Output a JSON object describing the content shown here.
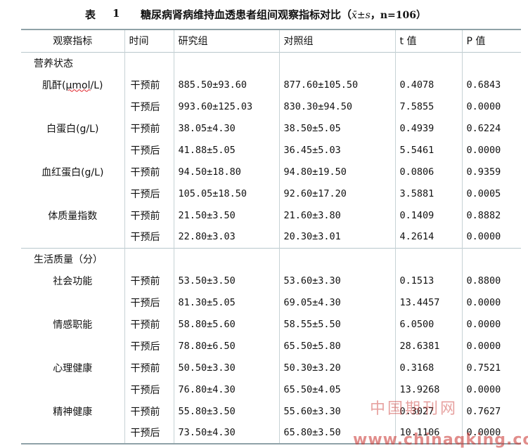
{
  "caption": {
    "label": "表",
    "number": "1",
    "title": "糖尿病肾病维持血透患者组间观察指标对比（",
    "stat": "x̄±s",
    "n": "，n=106）"
  },
  "headers": [
    "观察指标",
    "时间",
    "研究组",
    "对照组",
    "t 值",
    "P 值"
  ],
  "groups": [
    {
      "label": "营养状态",
      "rows": [
        {
          "indicator": "肌酐(μmol/L)",
          "time": "干预前",
          "study": "885.50±93.60",
          "control": "877.60±105.50",
          "t": "0.4078",
          "p": "0.6843"
        },
        {
          "indicator": "",
          "time": "干预后",
          "study": "993.60±125.03",
          "control": "830.30±94.50",
          "t": "7.5855",
          "p": "0.0000"
        },
        {
          "indicator": "白蛋白(g/L)",
          "time": "干预前",
          "study": "38.05±4.30",
          "control": "38.50±5.05",
          "t": "0.4939",
          "p": "0.6224"
        },
        {
          "indicator": "",
          "time": "干预后",
          "study": "41.88±5.05",
          "control": "36.45±5.03",
          "t": "5.5461",
          "p": "0.0000"
        },
        {
          "indicator": "血红蛋白(g/L)",
          "time": "干预前",
          "study": "94.50±18.80",
          "control": "94.80±19.50",
          "t": "0.0806",
          "p": "0.9359"
        },
        {
          "indicator": "",
          "time": "干预后",
          "study": "105.05±18.50",
          "control": "92.60±17.20",
          "t": "3.5881",
          "p": "0.0005"
        },
        {
          "indicator": "体质量指数",
          "time": "干预前",
          "study": "21.50±3.50",
          "control": "21.60±3.80",
          "t": "0.1409",
          "p": "0.8882"
        },
        {
          "indicator": "",
          "time": "干预后",
          "study": "22.80±3.03",
          "control": "20.30±3.01",
          "t": "4.2614",
          "p": "0.0000"
        }
      ]
    },
    {
      "label": "生活质量（分）",
      "rows": [
        {
          "indicator": "社会功能",
          "time": "干预前",
          "study": "53.50±3.50",
          "control": "53.60±3.30",
          "t": "0.1513",
          "p": "0.8800"
        },
        {
          "indicator": "",
          "time": "干预后",
          "study": "81.30±5.05",
          "control": "69.05±4.30",
          "t": "13.4457",
          "p": "0.0000"
        },
        {
          "indicator": "情感职能",
          "time": "干预前",
          "study": "58.80±5.60",
          "control": "58.55±5.50",
          "t": "6.0500",
          "p": "0.0000"
        },
        {
          "indicator": "",
          "time": "干预后",
          "study": "78.80±6.50",
          "control": "65.50±5.80",
          "t": "28.6381",
          "p": "0.0000"
        },
        {
          "indicator": "心理健康",
          "time": "干预前",
          "study": "50.50±3.30",
          "control": "50.30±3.20",
          "t": "0.3168",
          "p": "0.7521"
        },
        {
          "indicator": "",
          "time": "干预后",
          "study": "76.80±4.30",
          "control": "65.50±4.05",
          "t": "13.9268",
          "p": "0.0000"
        },
        {
          "indicator": "精神健康",
          "time": "干预前",
          "study": "55.80±3.50",
          "control": "55.60±3.30",
          "t": "0.3027",
          "p": "0.7627"
        },
        {
          "indicator": "",
          "time": "干预后",
          "study": "73.50±4.30",
          "control": "65.80±3.50",
          "t": "10.1106",
          "p": "0.0000"
        }
      ]
    }
  ],
  "watermark": {
    "cn": "中国期刊网",
    "url": "www.chinaqking.com",
    "color": "#c9302c"
  }
}
